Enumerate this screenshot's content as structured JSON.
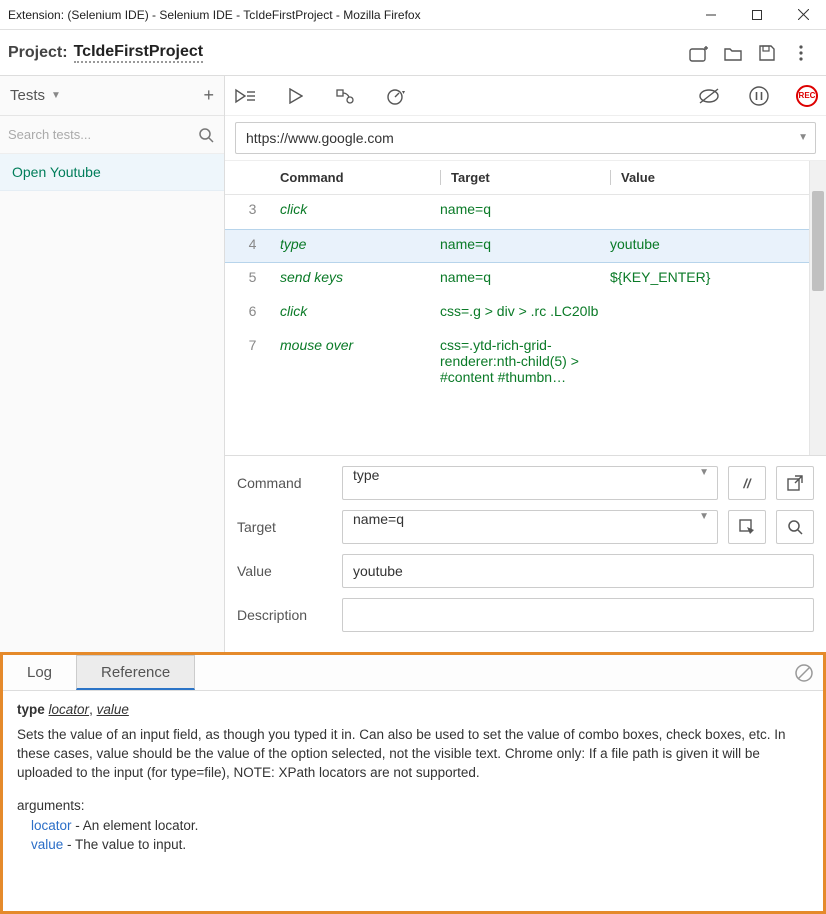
{
  "window_title": "Extension: (Selenium IDE) - Selenium IDE - TcIdeFirstProject - Mozilla Firefox",
  "project": {
    "label": "Project:",
    "name": "TcIdeFirstProject"
  },
  "sidebar": {
    "header": "Tests",
    "search_placeholder": "Search tests...",
    "items": [
      "Open Youtube"
    ]
  },
  "url": "https://www.google.com",
  "grid": {
    "headers": {
      "command": "Command",
      "target": "Target",
      "value": "Value"
    },
    "rows": [
      {
        "n": "3",
        "cmd": "click",
        "tgt": "name=q",
        "val": "",
        "selected": false
      },
      {
        "n": "4",
        "cmd": "type",
        "tgt": "name=q",
        "val": "youtube",
        "selected": true
      },
      {
        "n": "5",
        "cmd": "send keys",
        "tgt": "name=q",
        "val": "${KEY_ENTER}",
        "selected": false
      },
      {
        "n": "6",
        "cmd": "click",
        "tgt": "css=.g > div > .rc .LC20lb",
        "val": "",
        "selected": false
      },
      {
        "n": "7",
        "cmd": "mouse over",
        "tgt": "css=.ytd-rich-grid-renderer:nth-child(5) > #content #thumbn…",
        "val": "",
        "selected": false
      }
    ]
  },
  "editor": {
    "command_label": "Command",
    "command_value": "type",
    "target_label": "Target",
    "target_value": "name=q",
    "value_label": "Value",
    "value_value": "youtube",
    "description_label": "Description",
    "description_value": ""
  },
  "bottom": {
    "tabs": {
      "log": "Log",
      "reference": "Reference"
    },
    "ref": {
      "cmd": "type",
      "arg1": "locator",
      "arg2": "value",
      "desc": "Sets the value of an input field, as though you typed it in. Can also be used to set the value of combo boxes, check boxes, etc. In these cases, value should be the value of the option selected, not the visible text. Chrome only: If a file path is given it will be uploaded to the input (for type=file), NOTE: XPath locators are not supported.",
      "args_label": "arguments:",
      "a1_name": "locator",
      "a1_desc": " - An element locator.",
      "a2_name": "value",
      "a2_desc": " - The value to input."
    }
  },
  "rec_label": "REC"
}
